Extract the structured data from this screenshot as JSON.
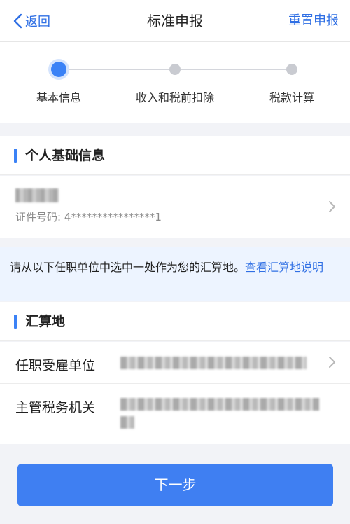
{
  "nav": {
    "back_label": "返回",
    "title": "标准申报",
    "reset_label": "重置申报"
  },
  "steps": [
    {
      "label": "基本信息",
      "state": "active"
    },
    {
      "label": "收入和税前扣除",
      "state": "pending"
    },
    {
      "label": "税款计算",
      "state": "pending"
    }
  ],
  "personal": {
    "section_title": "个人基础信息",
    "name": "",
    "id_label": "证件号码: 4****************1"
  },
  "notice": {
    "text": "请从以下任职单位中选中一处作为您的汇算地。",
    "link": "查看汇算地说明"
  },
  "settlement": {
    "section_title": "汇算地",
    "employer_label": "任职受雇单位",
    "tax_authority_label": "主管税务机关"
  },
  "footer": {
    "next_label": "下一步"
  },
  "colors": {
    "accent": "#3b82f6",
    "link": "#2f6fe4",
    "notice_bg": "#edf4ff"
  }
}
